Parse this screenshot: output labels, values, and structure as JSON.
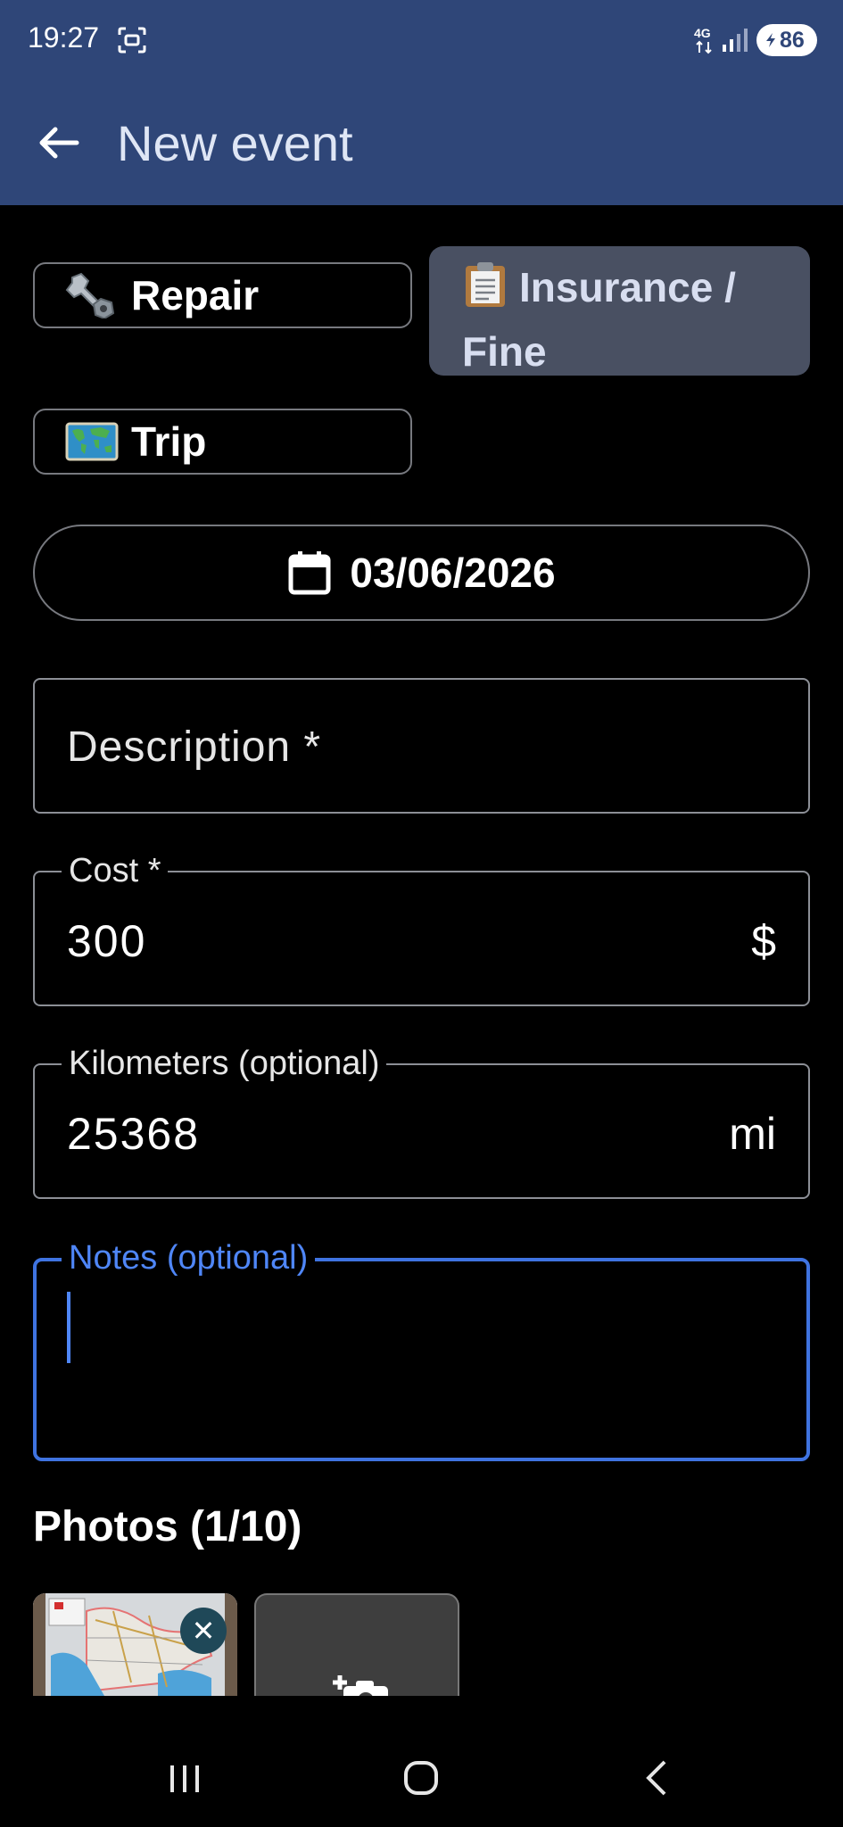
{
  "status_bar": {
    "time": "19:27",
    "network": "4G",
    "battery": "86"
  },
  "app_bar": {
    "title": "New event",
    "back_icon": "arrow-left-icon"
  },
  "event_types": [
    {
      "label": "Repair",
      "emoji": "wrench-nut-icon",
      "selected": false
    },
    {
      "label": "Insurance / Fine",
      "line1": "Insurance /",
      "line2": "Fine",
      "emoji": "clipboard-icon",
      "selected": true
    },
    {
      "label": "Trip",
      "emoji": "world-map-icon",
      "selected": false
    }
  ],
  "date": {
    "value": "03/06/2026",
    "icon": "calendar-icon"
  },
  "fields": {
    "description": {
      "placeholder": "Description *",
      "value": ""
    },
    "cost": {
      "label": "Cost *",
      "value": "300",
      "suffix": "$"
    },
    "kilometers": {
      "label": "Kilometers (optional)",
      "value": "25368",
      "suffix": "mi"
    },
    "notes": {
      "label": "Notes (optional)",
      "value": "",
      "focused": true
    }
  },
  "photos": {
    "title": "Photos (1/10)",
    "remove_symbol": "✕"
  },
  "colors": {
    "app_bar": "#2f4678",
    "selected_chip": "#495062",
    "focus": "#3f73e0",
    "background": "#000000"
  }
}
